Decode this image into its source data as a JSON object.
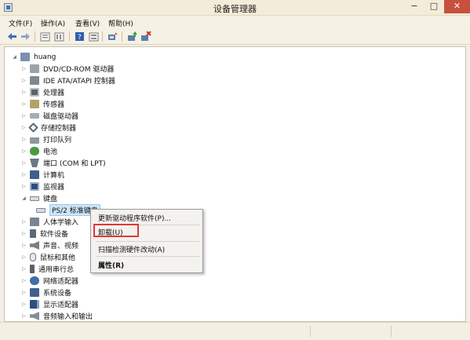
{
  "window": {
    "title": "设备管理器",
    "minimize": "−",
    "maximize": "□",
    "close": "✕"
  },
  "menubar": [
    "文件(F)",
    "操作(A)",
    "查看(V)",
    "帮助(H)"
  ],
  "toolbar_icons": [
    "back-icon",
    "forward-icon",
    "properties-icon",
    "list-icon",
    "help-icon",
    "view-icon",
    "scan-icon",
    "update-driver-icon",
    "uninstall-icon"
  ],
  "tree": {
    "root": "huang",
    "categories": [
      {
        "label": "DVD/CD-ROM 驱动器",
        "icon": "dvd-drive-icon",
        "expanded": false
      },
      {
        "label": "IDE ATA/ATAPI 控制器",
        "icon": "ide-controller-icon",
        "expanded": false
      },
      {
        "label": "处理器",
        "icon": "processor-icon",
        "expanded": false
      },
      {
        "label": "传感器",
        "icon": "sensor-icon",
        "expanded": false
      },
      {
        "label": "磁盘驱动器",
        "icon": "disk-drive-icon",
        "expanded": false
      },
      {
        "label": "存储控制器",
        "icon": "storage-controller-icon",
        "expanded": false
      },
      {
        "label": "打印队列",
        "icon": "printer-icon",
        "expanded": false
      },
      {
        "label": "电池",
        "icon": "battery-icon",
        "expanded": false
      },
      {
        "label": "端口 (COM 和 LPT)",
        "icon": "port-icon",
        "expanded": false
      },
      {
        "label": "计算机",
        "icon": "computer-icon",
        "expanded": false
      },
      {
        "label": "监视器",
        "icon": "monitor-icon",
        "expanded": false
      },
      {
        "label": "键盘",
        "icon": "keyboard-icon",
        "expanded": true
      },
      {
        "label": "人体学输入",
        "icon": "hid-icon",
        "expanded": false
      },
      {
        "label": "软件设备",
        "icon": "software-device-icon",
        "expanded": false
      },
      {
        "label": "声音、视频",
        "icon": "sound-icon",
        "expanded": false
      },
      {
        "label": "鼠标和其他",
        "icon": "mouse-icon",
        "expanded": false
      },
      {
        "label": "通用串行总",
        "icon": "usb-icon",
        "expanded": false
      },
      {
        "label": "网络适配器",
        "icon": "network-icon",
        "expanded": false
      },
      {
        "label": "系统设备",
        "icon": "system-device-icon",
        "expanded": false
      },
      {
        "label": "显示适配器",
        "icon": "display-adapter-icon",
        "expanded": false
      },
      {
        "label": "音频输入和输出",
        "icon": "audio-io-icon",
        "expanded": false
      }
    ],
    "keyboard_child": "PS/2 标准键盘"
  },
  "context_menu": {
    "update_driver": "更新驱动程序软件(P)...",
    "uninstall": "卸载(U)",
    "scan": "扫描检测硬件改动(A)",
    "properties": "属性(R)"
  },
  "colors": {
    "highlight_border": "#e23838",
    "selection_bg": "#cde6f7",
    "close_button": "#c7503f"
  }
}
